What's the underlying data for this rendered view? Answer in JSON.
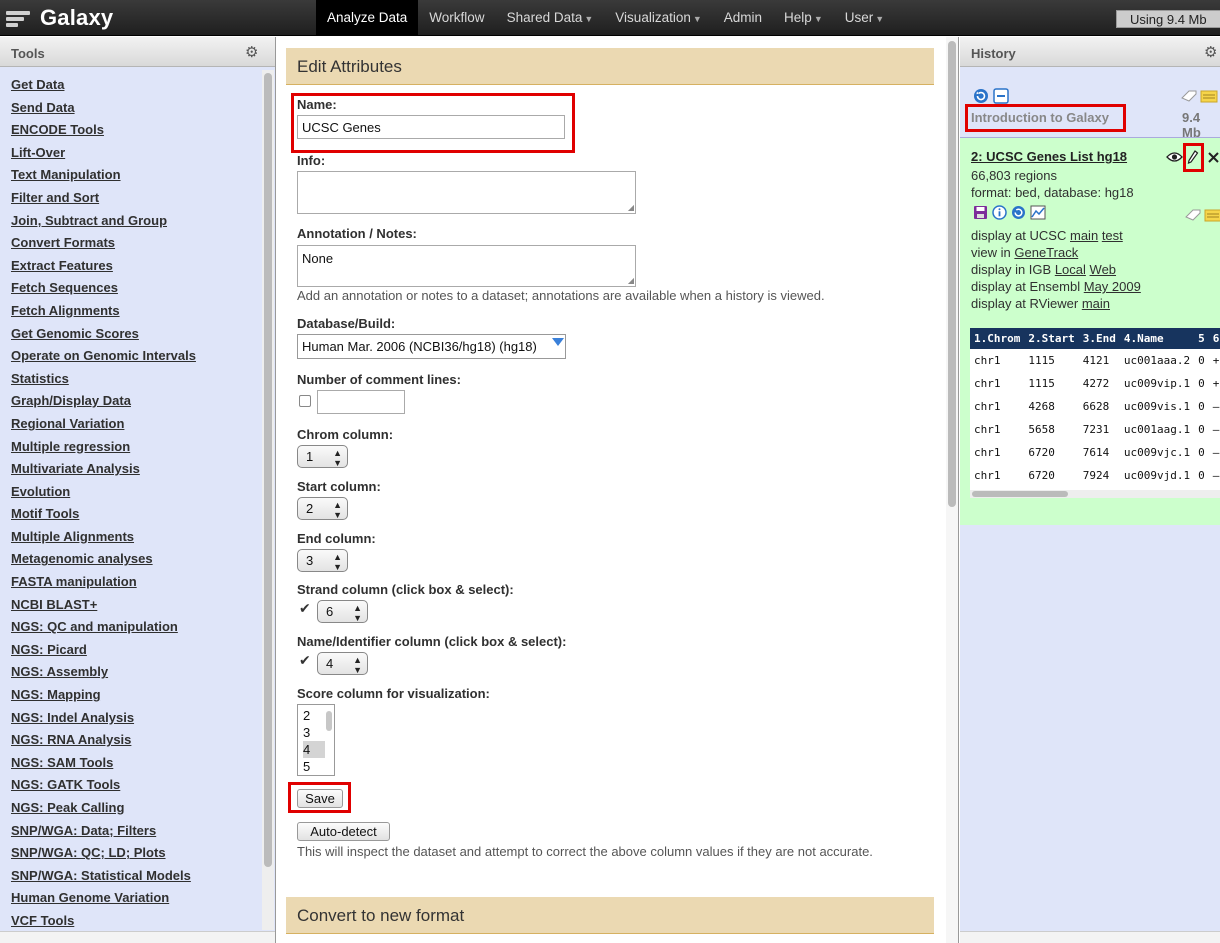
{
  "masthead": {
    "brand": "Galaxy",
    "tabs": [
      {
        "label": "Analyze Data",
        "dropdown": false
      },
      {
        "label": "Workflow",
        "dropdown": false
      },
      {
        "label": "Shared Data",
        "dropdown": true
      },
      {
        "label": "Visualization",
        "dropdown": true
      },
      {
        "label": "Admin",
        "dropdown": false
      },
      {
        "label": "Help",
        "dropdown": true
      },
      {
        "label": "User",
        "dropdown": true
      }
    ],
    "quota": "Using 9.4 Mb",
    "colors": {
      "bar": "#2b2b2b",
      "active": "#000000"
    }
  },
  "tools_panel": {
    "title": "Tools",
    "gear_icon": "gear-icon",
    "items": [
      "Get Data",
      "Send Data",
      "ENCODE Tools",
      "Lift-Over",
      "Text Manipulation",
      "Filter and Sort",
      "Join, Subtract and Group",
      "Convert Formats",
      "Extract Features",
      "Fetch Sequences",
      "Fetch Alignments",
      "Get Genomic Scores",
      "Operate on Genomic Intervals",
      "Statistics",
      "Graph/Display Data",
      "Regional Variation",
      "Multiple regression",
      "Multivariate Analysis",
      "Evolution",
      "Motif Tools",
      "Multiple Alignments",
      "Metagenomic analyses",
      "FASTA manipulation",
      "NCBI BLAST+",
      "NGS: QC and manipulation",
      "NGS: Picard",
      "NGS: Assembly",
      "NGS: Mapping",
      "NGS: Indel Analysis",
      "NGS: RNA Analysis",
      "NGS: SAM Tools",
      "NGS: GATK Tools",
      "NGS: Peak Calling",
      "SNP/WGA: Data; Filters",
      "SNP/WGA: QC; LD; Plots",
      "SNP/WGA: Statistical Models",
      "Human Genome Variation",
      "VCF Tools"
    ],
    "background": "#dfe5f9"
  },
  "edit_form": {
    "title": "Edit Attributes",
    "name_label": "Name:",
    "name_value": "UCSC Genes",
    "info_label": "Info:",
    "info_value": "",
    "annotation_label": "Annotation / Notes:",
    "annotation_value": "None",
    "annotation_help": "Add an annotation or notes to a dataset; annotations are available when a history is viewed.",
    "dbkey_label": "Database/Build:",
    "dbkey_value": "Human Mar. 2006 (NCBI36/hg18) (hg18)",
    "comment_lines_label": "Number of comment lines:",
    "comment_lines_checked": false,
    "comment_lines_value": "",
    "chrom_label": "Chrom column:",
    "chrom_value": "1",
    "start_label": "Start column:",
    "start_value": "2",
    "end_label": "End column:",
    "end_value": "3",
    "strand_label": "Strand column (click box & select):",
    "strand_checked": true,
    "strand_value": "6",
    "name_col_label": "Name/Identifier column (click box & select):",
    "name_col_checked": true,
    "name_col_value": "4",
    "score_label": "Score column for visualization:",
    "score_options": [
      "2",
      "3",
      "4",
      "5"
    ],
    "score_selected": "4",
    "save_label": "Save",
    "autodetect_label": "Auto-detect",
    "autodetect_help": "This will inspect the dataset and attempt to correct the above column values if they are not accurate.",
    "header_color": "#ebd9b2"
  },
  "convert_form": {
    "title": "Convert to new format"
  },
  "history": {
    "title": "History",
    "name": "Introduction to Galaxy",
    "size": "9.4 Mb",
    "dataset": {
      "title": "2: UCSC Genes List hg18",
      "regions": "66,803 regions",
      "format_line": "format: bed, database: hg18",
      "display_ucsc": "display at UCSC",
      "ucsc_links": [
        "main",
        "test"
      ],
      "view_in": "view in",
      "genetrack": "GeneTrack",
      "display_igb": "display in IGB",
      "igb_links": [
        "Local",
        "Web"
      ],
      "display_ensembl": "display at Ensembl",
      "ensembl_link": "May 2009",
      "display_rviewer": "display at RViewer",
      "rviewer_link": "main",
      "peek_headers": [
        "1.Chrom",
        "2.Start",
        "3.End",
        "4.Name",
        "5",
        "6"
      ],
      "peek_rows": [
        [
          "chr1",
          "1115",
          "4121",
          "uc001aaa.2",
          "0",
          "+"
        ],
        [
          "chr1",
          "1115",
          "4272",
          "uc009vip.1",
          "0",
          "+"
        ],
        [
          "chr1",
          "4268",
          "6628",
          "uc009vis.1",
          "0",
          "–"
        ],
        [
          "chr1",
          "5658",
          "7231",
          "uc001aag.1",
          "0",
          "–"
        ],
        [
          "chr1",
          "6720",
          "7614",
          "uc009vjc.1",
          "0",
          "–"
        ],
        [
          "chr1",
          "6720",
          "7924",
          "uc009vjd.1",
          "0",
          "–"
        ]
      ],
      "background": "#ccffcc",
      "peek_header_color": "#17345e"
    }
  },
  "highlight_color": "#e00000"
}
